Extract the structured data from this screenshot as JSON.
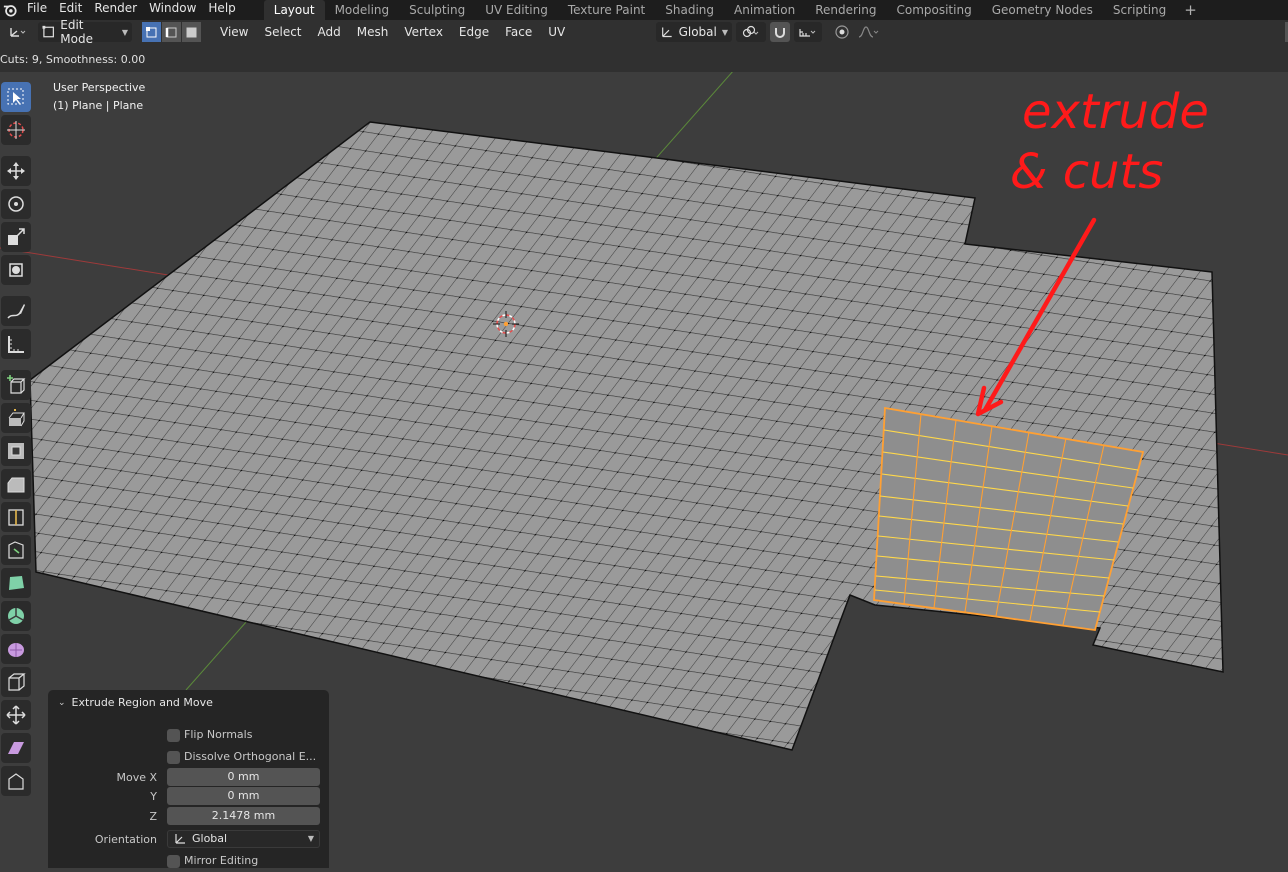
{
  "menubar": {
    "items": [
      "File",
      "Edit",
      "Render",
      "Window",
      "Help"
    ],
    "workspaces": [
      "Layout",
      "Modeling",
      "Sculpting",
      "UV Editing",
      "Texture Paint",
      "Shading",
      "Animation",
      "Rendering",
      "Compositing",
      "Geometry Nodes",
      "Scripting"
    ],
    "active_workspace": "Layout",
    "add_tab": "+"
  },
  "header": {
    "mode": "Edit Mode",
    "menus": [
      "View",
      "Select",
      "Add",
      "Mesh",
      "Vertex",
      "Edge",
      "Face",
      "UV"
    ],
    "orientation": "Global",
    "active_select_mode": "vertex"
  },
  "status": {
    "last_operation": "Cuts: 9, Smoothness: 0.00"
  },
  "viewport": {
    "view_name": "User Perspective",
    "object_info": "(1) Plane | Plane",
    "annotation_text_line1": "extrude",
    "annotation_text_line2": "& cuts",
    "annotation_color": "#ff1a1a",
    "selection_color": "#ffa033"
  },
  "toolbar": {
    "tools": [
      "select-box",
      "cursor",
      "move",
      "rotate",
      "scale",
      "transform",
      "annotate",
      "measure",
      "add-cube",
      "extrude-region",
      "inset-faces",
      "bevel",
      "loop-cut",
      "knife",
      "poly-build",
      "spin",
      "smooth",
      "edge-slide",
      "shrink-fatten",
      "shear",
      "rip-region"
    ],
    "active_tool": "select-box"
  },
  "operator_panel": {
    "title": "Extrude Region and Move",
    "flip_normals_label": "Flip Normals",
    "flip_normals": false,
    "dissolve_label": "Dissolve Orthogonal E...",
    "dissolve": false,
    "move_x_label": "Move X",
    "move_x": "0 mm",
    "move_y_label": "Y",
    "move_y": "0 mm",
    "move_z_label": "Z",
    "move_z": "2.1478 mm",
    "orientation_label": "Orientation",
    "orientation": "Global",
    "mirror_label": "Mirror Editing",
    "mirror": false
  }
}
